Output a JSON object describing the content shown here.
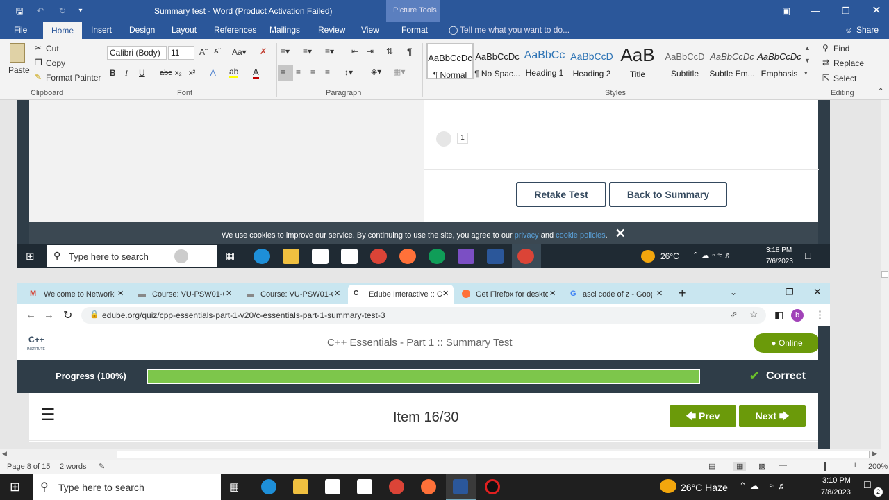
{
  "word": {
    "title": "Summary test - Word (Product Activation Failed)",
    "context_tab": "Picture Tools",
    "tabs": [
      "File",
      "Home",
      "Insert",
      "Design",
      "Layout",
      "References",
      "Mailings",
      "Review",
      "View",
      "Format"
    ],
    "tell_me": "Tell me what you want to do...",
    "share": "Share",
    "clipboard": {
      "paste": "Paste",
      "cut": "Cut",
      "copy": "Copy",
      "format_painter": "Format Painter",
      "group": "Clipboard"
    },
    "font": {
      "name": "Calibri (Body)",
      "size": "11",
      "group": "Font"
    },
    "paragraph_group": "Paragraph",
    "styles": [
      {
        "preview": "AaBbCcDc",
        "name": "¶ Normal"
      },
      {
        "preview": "AaBbCcDc",
        "name": "¶ No Spac..."
      },
      {
        "preview": "AaBbCc",
        "name": "Heading 1"
      },
      {
        "preview": "AaBbCcD",
        "name": "Heading 2"
      },
      {
        "preview": "AaB",
        "name": "Title"
      },
      {
        "preview": "AaBbCcD",
        "name": "Subtitle"
      },
      {
        "preview": "AaBbCcDc",
        "name": "Subtle Em..."
      },
      {
        "preview": "AaBbCcDc",
        "name": "Emphasis"
      }
    ],
    "styles_group": "Styles",
    "editing": {
      "find": "Find",
      "replace": "Replace",
      "select": "Select",
      "group": "Editing"
    },
    "status": {
      "page": "Page 8 of 15",
      "words": "2 words",
      "zoom": "200%"
    }
  },
  "emb_top": {
    "option_num": "1",
    "retake": "Retake Test",
    "back": "Back to Summary",
    "cookie_text": "We use cookies to improve our service. By continuing to use the site, you agree to our",
    "cookie_privacy": "privacy",
    "cookie_and": "and",
    "cookie_policies": "cookie policies",
    "cookie_dot": ".",
    "search": "Type here to search",
    "weather": "26°C",
    "time": "3:18 PM",
    "date": "7/6/2023"
  },
  "emb_chrome": {
    "tabs": [
      "Welcome to Networki",
      "Course: VU-PSW01-C",
      "Course: VU-PSW01-C",
      "Edube Interactive :: C",
      "Get Firefox for deskto",
      "asci code of z - Goog"
    ],
    "url": "edube.org/quiz/cpp-essentials-part-1-v20/c-essentials-part-1-summary-test-3",
    "avatar": "b",
    "logo": "C++",
    "logo_sub": "INSTITUTE",
    "site_title": "C++ Essentials - Part 1 :: Summary Test",
    "online": "Online",
    "progress_label": "Progress (100%)",
    "progress": 1.0,
    "result": "Correct",
    "item": "Item 16/30",
    "prev": "Prev",
    "next": "Next"
  },
  "taskbar": {
    "search": "Type here to search",
    "weather": "26°C  Haze",
    "time": "3:10 PM",
    "date": "7/8/2023",
    "notif": "2"
  },
  "colors": {
    "word_blue": "#2b579a",
    "edube_dark": "#2f3d48",
    "green": "#6b9a0a",
    "progress_fill": "#7dc64b"
  }
}
